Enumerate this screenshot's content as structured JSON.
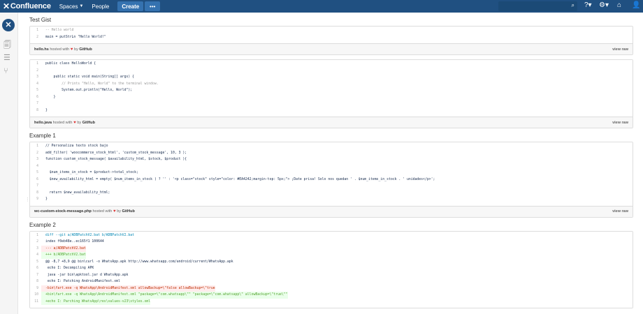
{
  "topbar": {
    "logo": "Confluence",
    "spaces": "Spaces",
    "people": "People",
    "create": "Create",
    "more": "•••"
  },
  "sections": [
    {
      "title": "Test Gist",
      "gists": [
        {
          "file": "hello.hs",
          "hosted": "hosted with",
          "by": "by",
          "github": "GitHub",
          "view_raw": "view raw",
          "lines": [
            {
              "n": "1",
              "t": "-- Hello world",
              "cls": "c-comment"
            },
            {
              "n": "2",
              "t": "main = putStrLn \"Hello World!\"",
              "cls": ""
            }
          ]
        },
        {
          "file": "hello.java",
          "hosted": "hosted with",
          "by": "by",
          "github": "GitHub",
          "view_raw": "view raw",
          "lines": [
            {
              "n": "1",
              "t": "public class HelloWorld {",
              "cls": ""
            },
            {
              "n": "2",
              "t": "",
              "cls": ""
            },
            {
              "n": "3",
              "t": "    public static void main(String[] args) {",
              "cls": ""
            },
            {
              "n": "4",
              "t": "        // Prints \"Hello, World\" to the terminal window.",
              "cls": "c-comment"
            },
            {
              "n": "5",
              "t": "        System.out.println(\"Hello, World\");",
              "cls": ""
            },
            {
              "n": "6",
              "t": "    }",
              "cls": ""
            },
            {
              "n": "7",
              "t": "",
              "cls": ""
            },
            {
              "n": "8",
              "t": "}",
              "cls": ""
            }
          ]
        }
      ]
    },
    {
      "title": "Example 1",
      "gists": [
        {
          "file": "wc-custom-stock-message.php",
          "hosted": "hosted with",
          "by": "by",
          "github": "GitHub",
          "view_raw": "view raw",
          "lines": [
            {
              "n": "1",
              "t": "// Personaliza texto stock bajo",
              "cls": ""
            },
            {
              "n": "2",
              "t": "add_filter( 'woocommerce_stock_html', 'custom_stock_message', 10, 3 );",
              "cls": ""
            },
            {
              "n": "3",
              "t": "function custom_stock_message( $availability_html, $stock, $product ){",
              "cls": ""
            },
            {
              "n": "4",
              "t": "",
              "cls": ""
            },
            {
              "n": "5",
              "t": "  $num_items_in_stock = $product->total_stock;",
              "cls": ""
            },
            {
              "n": "6",
              "t": "  $new_availability_html = empty( $num_items_in_stock ) ? '' : '<p class=\"stock\" style=\"color: #EA4242;margin-top: 5px;\"> ¡Date prisa! Solo nos quedan ' . $num_items_in_stock . ' unidades</p>';",
              "cls": ""
            },
            {
              "n": "7",
              "t": "",
              "cls": ""
            },
            {
              "n": "8",
              "t": "  return $new_availability_html;",
              "cls": ""
            },
            {
              "n": "9",
              "t": "}",
              "cls": ""
            }
          ]
        }
      ]
    },
    {
      "title": "Example 2",
      "gists": [
        {
          "file": "",
          "hosted": "",
          "by": "",
          "github": "",
          "view_raw": "",
          "lines": [
            {
              "n": "1",
              "t": "diff --git a/ADBPatchV2.bat b/ADBPatchV2.bat",
              "cls": "c-blue"
            },
            {
              "n": "2",
              "t": "index f0eb48e..ec165f1 100644",
              "cls": ""
            },
            {
              "n": "3",
              "t": "--- a/ADBPatchV2.bat",
              "cls": "c-del"
            },
            {
              "n": "4",
              "t": "+++ b/ADBPatchV2.bat",
              "cls": "c-add"
            },
            {
              "n": "5",
              "t": "@@ -8,7 +8,9 @@ bin\\curl -o WhatsApp.apk http://www.whatsapp.com/android/current/WhatsApp.apk",
              "cls": ""
            },
            {
              "n": "6",
              "t": " echo I: Decompiling APK",
              "cls": ""
            },
            {
              "n": "7",
              "t": " java -jar bin\\apktool.jar d WhatsApp.apk",
              "cls": ""
            },
            {
              "n": "8",
              "t": " echo I: Patching AndroidManifest.xml",
              "cls": ""
            },
            {
              "n": "9",
              "t": "-bin\\fart.exe -q WhatsApp\\AndroidManifest.xml allowBackup=\\\"false allowBackup=\\\"true",
              "cls": "c-del"
            },
            {
              "n": "10",
              "t": "+bin\\fart.exe -q WhatsApp\\AndroidManifest.xml \"package=\\\"com.whatsapp\\\"\" \"package=\\\"com.whatsapp\\\" allowBackup=\\\"true\\\"\"",
              "cls": "c-add"
            },
            {
              "n": "11",
              "t": "+echo I: Parching WhatsApp\\res\\values-v23\\styles.xml",
              "cls": "c-add"
            }
          ]
        }
      ]
    }
  ]
}
